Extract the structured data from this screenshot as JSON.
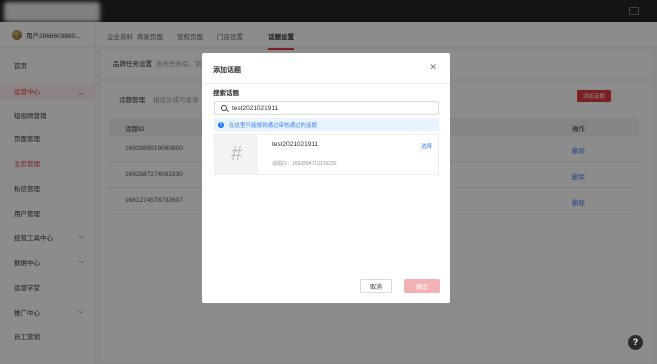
{
  "account": {
    "name": "用户2866603880..."
  },
  "top_tabs": [
    "企业资料",
    "商家页面",
    "营权页面",
    "门店设置",
    "话题设置"
  ],
  "active_top_tab": "话题设置",
  "sidebar": {
    "items": [
      {
        "label": "首页"
      },
      {
        "label": "运营中心",
        "expanded": true
      },
      {
        "label": "短视频营销"
      },
      {
        "label": "页面管理"
      },
      {
        "label": "主页管理"
      },
      {
        "label": "私信管理"
      },
      {
        "label": "用户管理"
      },
      {
        "label": "经营工具中心"
      },
      {
        "label": "数据中心"
      },
      {
        "label": "运营学堂"
      },
      {
        "label": "推广中心"
      },
      {
        "label": "员工营销"
      }
    ]
  },
  "background": {
    "subnav": {
      "title": "品牌任务设置",
      "hint": "发布任务后，到..."
    },
    "inner_tabs": {
      "first": "话题管理",
      "second": "相话生成可查询"
    },
    "add_topic_label": "添加话题",
    "table": {
      "headers": [
        "话题ID",
        "操作"
      ],
      "rows": [
        {
          "id": "1692889919080800",
          "op": "删除"
        },
        {
          "id": "1692887274083330",
          "op": "删除"
        },
        {
          "id": "1681274578732607",
          "op": "删除"
        }
      ]
    }
  },
  "dialog": {
    "title": "添加话题",
    "search_label": "搜索话题",
    "search_value": "test2021021911",
    "tip": "在这里只能搜到通过审核通过的话题",
    "result": {
      "name": "test2021021911",
      "id_text": "话题ID：1692894713139239",
      "action": "选择"
    },
    "cancel_label": "取消",
    "confirm_label": "确定"
  },
  "help_label": "?",
  "colors": {
    "accent": "#e0393f",
    "link": "#3b82f6",
    "topbar": "#25262b"
  }
}
